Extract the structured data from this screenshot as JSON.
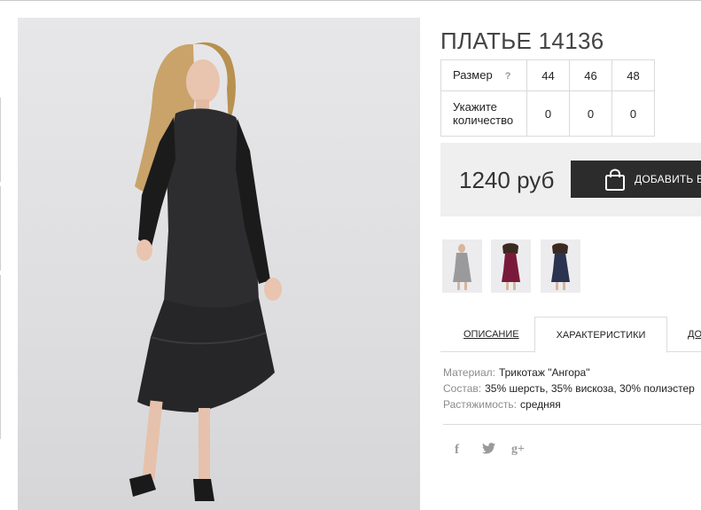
{
  "product": {
    "title": "ПЛАТЬЕ 14136"
  },
  "sizes": {
    "size_label": "Размер",
    "help_mark": "?",
    "qty_label": "Укажите количество",
    "values": [
      "44",
      "46",
      "48"
    ],
    "quantities": [
      "0",
      "0",
      "0"
    ]
  },
  "purchase": {
    "price": "1240 руб",
    "add_button_label": "ДОБАВИТЬ В",
    "add_button_icon": "shopping-bag-icon"
  },
  "thumbnails": [
    {
      "color": "grey"
    },
    {
      "color": "burgundy"
    },
    {
      "color": "navy"
    }
  ],
  "tabs": {
    "description": "ОПИСАНИЕ",
    "characteristics": "ХАРАКТЕРИСТИКИ",
    "more": "ДО"
  },
  "specs": [
    {
      "key": "Материал:",
      "value": "Трикотаж \"Ангора\""
    },
    {
      "key": "Состав:",
      "value": "35% шерсть, 35% вискоза, 30% полиэстер"
    },
    {
      "key": "Растяжимость:",
      "value": "средняя"
    }
  ],
  "social": {
    "facebook": "f",
    "twitter": "twitter-icon",
    "google_plus": "g+"
  },
  "colors": {
    "price_bar_bg": "#efefef",
    "button_bg": "#2c2c2c",
    "dress_main": "#2d2d2f"
  }
}
